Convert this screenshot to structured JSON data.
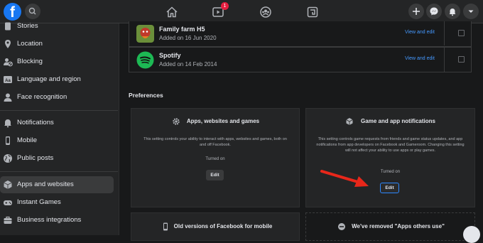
{
  "topbar": {
    "logo": "f",
    "icons": [
      "search-icon",
      "home-icon",
      "watch-icon",
      "groups-icon",
      "gaming-icon",
      "plus-icon",
      "messenger-icon",
      "notifications-icon",
      "account-chevron-icon"
    ],
    "watch_badge": "1"
  },
  "sidebar": {
    "items": [
      {
        "label": "Stories",
        "icon": "stories-icon"
      },
      {
        "label": "Location",
        "icon": "location-pin-icon"
      },
      {
        "label": "Blocking",
        "icon": "blocking-icon"
      },
      {
        "label": "Language and region",
        "icon": "language-icon"
      },
      {
        "label": "Face recognition",
        "icon": "face-recognition-icon"
      },
      {
        "label": "Notifications",
        "icon": "bell-icon"
      },
      {
        "label": "Mobile",
        "icon": "mobile-icon"
      },
      {
        "label": "Public posts",
        "icon": "globe-icon"
      },
      {
        "label": "Apps and websites",
        "icon": "apps-cube-icon"
      },
      {
        "label": "Instant Games",
        "icon": "game-controller-icon"
      },
      {
        "label": "Business integrations",
        "icon": "business-icon"
      }
    ]
  },
  "apps": [
    {
      "name": "Family farm H5",
      "added": "Added on 16 Jun 2020",
      "link": "View and edit"
    },
    {
      "name": "Spotify",
      "added": "Added on 14 Feb 2014",
      "link": "View and edit"
    }
  ],
  "preferences": {
    "title": "Preferences",
    "cards": [
      {
        "title": "Apps, websites and games",
        "icon": "gear-icon",
        "description": "This setting controls your ability to interact with apps, websites and games, both on and off Facebook.",
        "status": "Turned on",
        "button": "Edit"
      },
      {
        "title": "Game and app notifications",
        "icon": "cube-icon",
        "description": "This setting controls game requests from friends and game status updates, and app notifications from app developers on Facebook and Gameroom. Changing this setting will not affect your ability to use apps or play games.",
        "status": "Turned on",
        "button": "Edit"
      },
      {
        "title": "Old versions of Facebook for mobile",
        "icon": "phone-icon"
      },
      {
        "title": "We've removed \"Apps others use\"",
        "icon": "minus-circle-icon"
      }
    ]
  },
  "colors": {
    "accent": "#2d88ff",
    "link": "#4599ff",
    "arrow": "#e8271a",
    "background": "#18191a",
    "surface": "#242526"
  }
}
